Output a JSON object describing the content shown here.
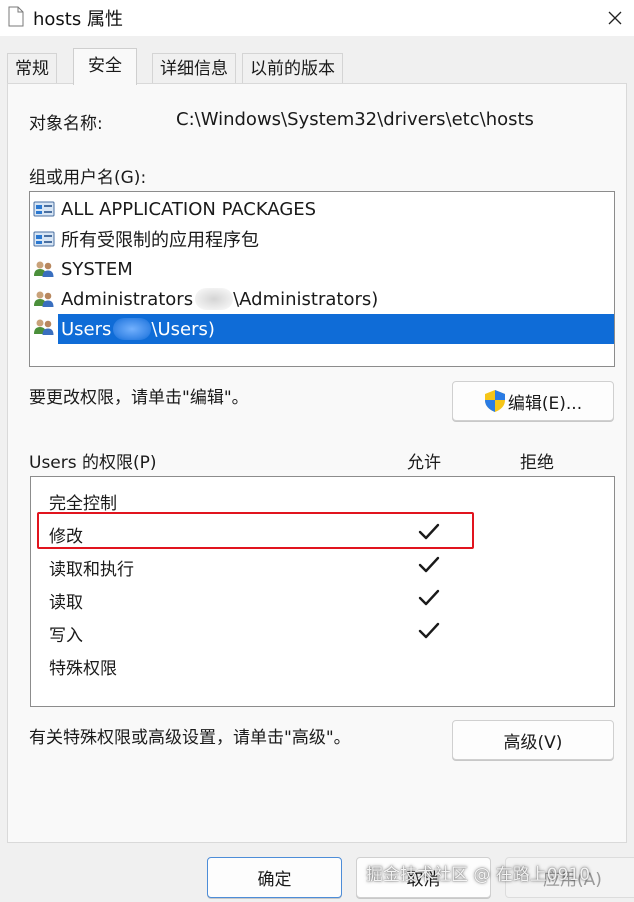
{
  "window": {
    "title": "hosts 属性",
    "close_icon": "close-icon"
  },
  "tabs": [
    {
      "label": "常规",
      "active": false
    },
    {
      "label": "安全",
      "active": true
    },
    {
      "label": "详细信息",
      "active": false
    },
    {
      "label": "以前的版本",
      "active": false
    }
  ],
  "object": {
    "label": "对象名称:",
    "value": "C:\\Windows\\System32\\drivers\\etc\\hosts"
  },
  "groups": {
    "label": "组或用户名(G):",
    "items": [
      {
        "name": "ALL APPLICATION PACKAGES",
        "icon": "package-group-icon"
      },
      {
        "name": "所有受限制的应用程序包",
        "icon": "package-group-icon"
      },
      {
        "name": "SYSTEM",
        "icon": "users-icon"
      },
      {
        "name_prefix": "Administrators ",
        "name_suffix": "\\Administrators)",
        "icon": "users-icon"
      },
      {
        "name_prefix": "Users ",
        "name_suffix": "\\Users)",
        "icon": "users-icon",
        "selected": true
      }
    ]
  },
  "edit": {
    "hint": "要更改权限，请单击\"编辑\"。",
    "button": "编辑(E)...",
    "icon": "uac-shield-icon"
  },
  "permissions": {
    "title": "Users 的权限(P)",
    "allow_header": "允许",
    "deny_header": "拒绝",
    "rows": [
      {
        "name": "完全控制",
        "allow": false,
        "deny": false
      },
      {
        "name": "修改",
        "allow": true,
        "deny": false,
        "highlighted": true
      },
      {
        "name": "读取和执行",
        "allow": true,
        "deny": false
      },
      {
        "name": "读取",
        "allow": true,
        "deny": false
      },
      {
        "name": "写入",
        "allow": true,
        "deny": false
      },
      {
        "name": "特殊权限",
        "allow": false,
        "deny": false
      }
    ]
  },
  "advanced": {
    "hint": "有关特殊权限或高级设置，请单击\"高级\"。",
    "button": "高级(V)"
  },
  "footer": {
    "ok": "确定",
    "cancel": "取消",
    "apply": "应用(A)"
  },
  "watermark": "掘金技术社区 @ 在路上0910",
  "colors": {
    "selection": "#0f6cd7",
    "highlight_border": "#e1141e",
    "panel_bg": "#f9f9f9"
  }
}
